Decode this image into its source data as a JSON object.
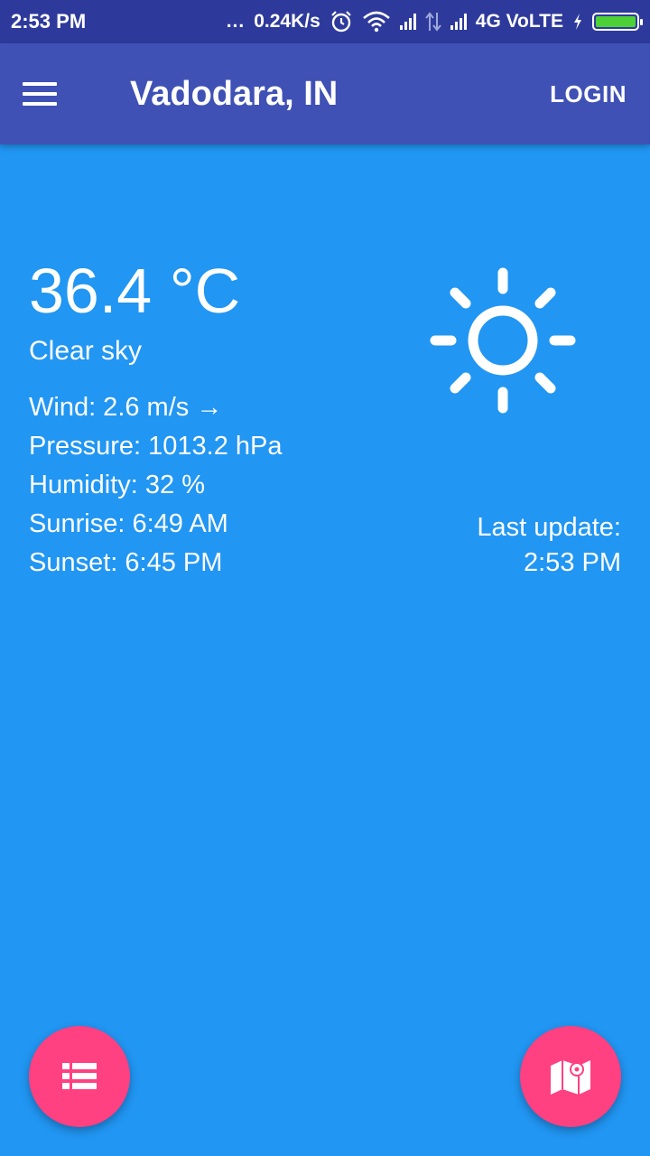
{
  "status_bar": {
    "time": "2:53 PM",
    "dots": "...",
    "speed": "0.24K/s",
    "network": "4G VoLTE",
    "icons": [
      "alarm-icon",
      "wifi-icon",
      "signal-icon",
      "data-arrows-icon",
      "signal-icon",
      "charging-icon",
      "battery-icon"
    ]
  },
  "app_bar": {
    "title": "Vadodara, IN",
    "login_label": "LOGIN",
    "menu_icon": "menu-icon"
  },
  "weather": {
    "temperature": "36.4 °C",
    "description": "Clear sky",
    "wind": "Wind: 2.6 m/s →",
    "pressure": "Pressure: 1013.2 hPa",
    "humidity": "Humidity: 32 %",
    "sunrise": "Sunrise: 6:49 AM",
    "sunset": "Sunset: 6:45 PM",
    "icon": "sun-icon",
    "last_update_label": "Last update:",
    "last_update_time": "2:53 PM"
  },
  "fabs": {
    "left_icon": "list-icon",
    "right_icon": "map-icon"
  },
  "colors": {
    "background": "#2196F3",
    "app_bar": "#3F51B5",
    "status_bar": "#2E3A9B",
    "fab": "#FF4081",
    "text": "#FFFFFF"
  }
}
